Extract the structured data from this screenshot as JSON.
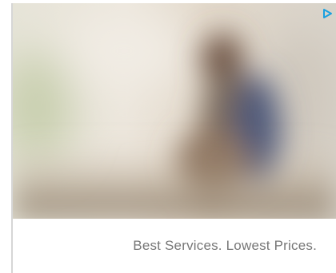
{
  "ad": {
    "headline": "Best Services. Lowest Prices.",
    "image_description_icon": "blurred-photo",
    "choices_icon": "adchoices-triangle-icon",
    "colors": {
      "caption_text": "#777777",
      "frame_border": "#d6d6d6",
      "choices_icon": "#19a0e0"
    }
  }
}
